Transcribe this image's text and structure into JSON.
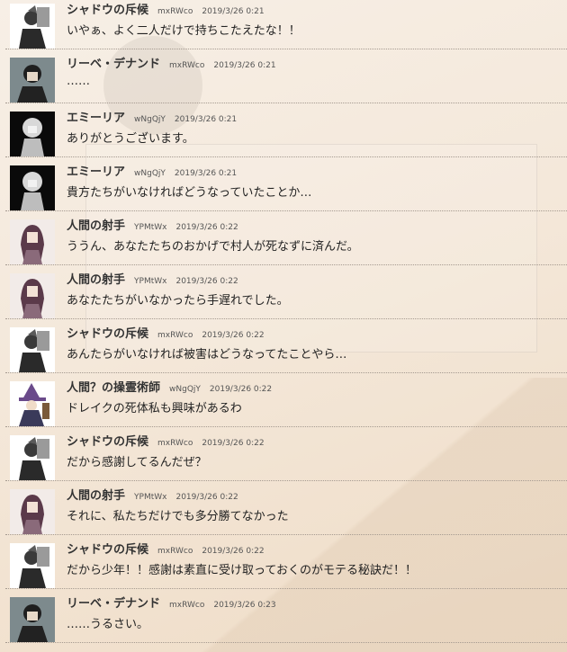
{
  "messages": [
    {
      "avatar": "shadow-scout-avatar",
      "name": "シャドウの斥候",
      "uid": "mxRWco",
      "time": "2019/3/26 0:21",
      "text": "いやぁ、よく二人だけで持ちこたえたな！！"
    },
    {
      "avatar": "riebe-avatar",
      "name": "リーベ・デナンド",
      "uid": "mxRWco",
      "time": "2019/3/26 0:21",
      "text": "……"
    },
    {
      "avatar": "emilia-avatar",
      "name": "エミーリア",
      "uid": "wNgQjY",
      "time": "2019/3/26 0:21",
      "text": "ありがとうございます。"
    },
    {
      "avatar": "emilia-avatar",
      "name": "エミーリア",
      "uid": "wNgQjY",
      "time": "2019/3/26 0:21",
      "text": "貴方たちがいなければどうなっていたことか…"
    },
    {
      "avatar": "archer-avatar",
      "name": "人間の射手",
      "uid": "YPMtWx",
      "time": "2019/3/26 0:22",
      "text": "ううん、あなたたちのおかげで村人が死なずに済んだ。"
    },
    {
      "avatar": "archer-avatar",
      "name": "人間の射手",
      "uid": "YPMtWx",
      "time": "2019/3/26 0:22",
      "text": "あなたたちがいなかったら手遅れでした。"
    },
    {
      "avatar": "shadow-scout-avatar",
      "name": "シャドウの斥候",
      "uid": "mxRWco",
      "time": "2019/3/26 0:22",
      "text": "あんたらがいなければ被害はどうなってたことやら…"
    },
    {
      "avatar": "necromancer-avatar",
      "name": "人間？の操霊術師",
      "uid": "wNgQjY",
      "time": "2019/3/26 0:22",
      "text": "ドレイクの死体私も興味があるわ"
    },
    {
      "avatar": "shadow-scout-avatar",
      "name": "シャドウの斥候",
      "uid": "mxRWco",
      "time": "2019/3/26 0:22",
      "text": "だから感謝してるんだぜ？"
    },
    {
      "avatar": "archer-avatar",
      "name": "人間の射手",
      "uid": "YPMtWx",
      "time": "2019/3/26 0:22",
      "text": "それに、私たちだけでも多分勝てなかった"
    },
    {
      "avatar": "shadow-scout-avatar",
      "name": "シャドウの斥候",
      "uid": "mxRWco",
      "time": "2019/3/26 0:22",
      "text": "だから少年！！感謝は素直に受け取っておくのがモテる秘訣だ！！"
    },
    {
      "avatar": "riebe-avatar",
      "name": "リーベ・デナンド",
      "uid": "mxRWco",
      "time": "2019/3/26 0:23",
      "text": "……うるさい。"
    }
  ]
}
